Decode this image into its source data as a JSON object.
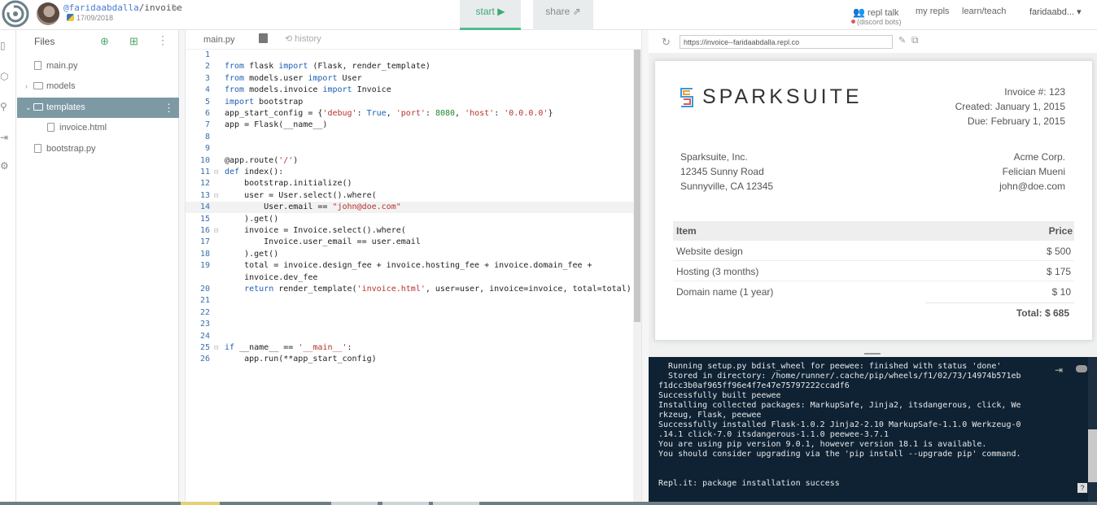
{
  "header": {
    "owner": "@faridaabdalla",
    "repl": "invoice",
    "date": "17/09/2018",
    "start_label": "start ▶",
    "share_label": "share",
    "nav": {
      "repl_talk": "repl talk",
      "discord": "(discord bots)",
      "my_repls": "my repls",
      "learn_teach": "learn/teach",
      "user": "faridaabd... ▾"
    }
  },
  "files": {
    "title": "Files",
    "items": [
      {
        "label": "main.py",
        "type": "file"
      },
      {
        "label": "models",
        "type": "folder"
      },
      {
        "label": "templates",
        "type": "folder",
        "selected": true
      },
      {
        "label": "invoice.html",
        "type": "file"
      },
      {
        "label": "bootstrap.py",
        "type": "file"
      }
    ]
  },
  "editor": {
    "tab": "main.py",
    "history": "history",
    "lines": [
      {
        "n": "1",
        "code": ""
      },
      {
        "n": "2",
        "code": "from flask import (Flask, render_template)"
      },
      {
        "n": "3",
        "code": "from models.user import User"
      },
      {
        "n": "4",
        "code": "from models.invoice import Invoice"
      },
      {
        "n": "5",
        "code": "import bootstrap"
      },
      {
        "n": "6",
        "code": "app_start_config = {'debug': True, 'port': 8080, 'host': '0.0.0.0'}"
      },
      {
        "n": "7",
        "code": "app = Flask(__name__)"
      },
      {
        "n": "8",
        "code": ""
      },
      {
        "n": "9",
        "code": ""
      },
      {
        "n": "10",
        "code": "@app.route('/')"
      },
      {
        "n": "11",
        "code": "def index():"
      },
      {
        "n": "12",
        "code": "    bootstrap.initialize()"
      },
      {
        "n": "13",
        "code": "    user = User.select().where("
      },
      {
        "n": "14",
        "code": "        User.email == \"john@doe.com\""
      },
      {
        "n": "15",
        "code": "    ).get()"
      },
      {
        "n": "16",
        "code": "    invoice = Invoice.select().where("
      },
      {
        "n": "17",
        "code": "        Invoice.user_email == user.email"
      },
      {
        "n": "18",
        "code": "    ).get()"
      },
      {
        "n": "19",
        "code": "    total = invoice.design_fee + invoice.hosting_fee + invoice.domain_fee +"
      },
      {
        "n": "",
        "code": "    invoice.dev_fee"
      },
      {
        "n": "20",
        "code": "    return render_template('invoice.html', user=user, invoice=invoice, total=total)"
      },
      {
        "n": "21",
        "code": ""
      },
      {
        "n": "22",
        "code": ""
      },
      {
        "n": "23",
        "code": ""
      },
      {
        "n": "24",
        "code": ""
      },
      {
        "n": "25",
        "code": "if __name__ == '__main__':"
      },
      {
        "n": "26",
        "code": "    app.run(**app_start_config)"
      }
    ]
  },
  "browser": {
    "url": "https://invoice--faridaabdalla.repl.co"
  },
  "invoice": {
    "brand": "SPARKSUITE",
    "number": "Invoice #: 123",
    "created": "Created: January 1, 2015",
    "due": "Due: February 1, 2015",
    "from": [
      "Sparksuite, Inc.",
      "12345 Sunny Road",
      "Sunnyville, CA 12345"
    ],
    "to": [
      "Acme Corp.",
      "Felician Mueni",
      "john@doe.com"
    ],
    "col_item": "Item",
    "col_price": "Price",
    "rows": [
      {
        "item": "Website design",
        "price": "$ 500"
      },
      {
        "item": "Hosting (3 months)",
        "price": "$ 175"
      },
      {
        "item": "Domain name (1 year)",
        "price": "$ 10"
      }
    ],
    "total": "Total: $ 685"
  },
  "console": {
    "lines": [
      "  Running setup.py bdist_wheel for peewee: finished with status 'done'",
      "  Stored in directory: /home/runner/.cache/pip/wheels/f1/02/73/14974b571eb",
      "f1dcc3b0af965ff96e4f7e47e75797222ccadf6",
      "Successfully built peewee",
      "Installing collected packages: MarkupSafe, Jinja2, itsdangerous, click, We",
      "rkzeug, Flask, peewee",
      "Successfully installed Flask-1.0.2 Jinja2-2.10 MarkupSafe-1.1.0 Werkzeug-0",
      ".14.1 click-7.0 itsdangerous-1.1.0 peewee-3.7.1",
      "You are using pip version 9.0.1, however version 18.1 is available.",
      "You should consider upgrading via the 'pip install --upgrade pip' command.",
      "",
      "",
      "Repl.it: package installation success"
    ],
    "help": "?"
  }
}
